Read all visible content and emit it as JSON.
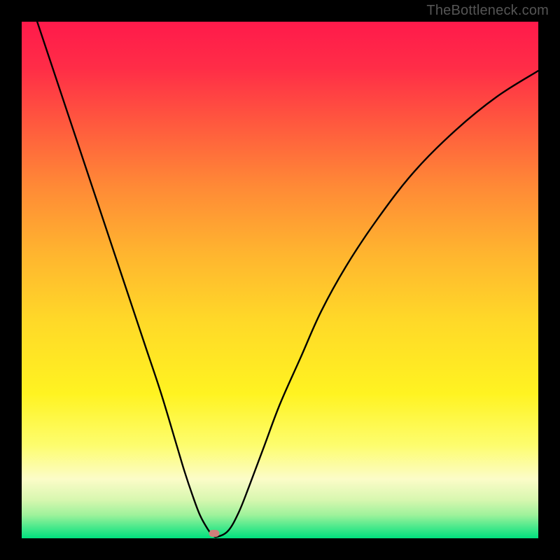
{
  "watermark": "TheBottleneck.com",
  "chart_data": {
    "type": "line",
    "title": "",
    "xlabel": "",
    "ylabel": "",
    "xlim": [
      0,
      100
    ],
    "ylim": [
      0,
      100
    ],
    "grid": false,
    "legend": false,
    "background_gradient": {
      "stops": [
        {
          "pos": 0.0,
          "color": "#ff1a4b"
        },
        {
          "pos": 0.09,
          "color": "#ff2d47"
        },
        {
          "pos": 0.2,
          "color": "#ff5a3e"
        },
        {
          "pos": 0.32,
          "color": "#ff8a36"
        },
        {
          "pos": 0.45,
          "color": "#ffb52f"
        },
        {
          "pos": 0.58,
          "color": "#ffd928"
        },
        {
          "pos": 0.72,
          "color": "#fff321"
        },
        {
          "pos": 0.82,
          "color": "#fdfd6e"
        },
        {
          "pos": 0.885,
          "color": "#fcfcc8"
        },
        {
          "pos": 0.925,
          "color": "#d8f7b0"
        },
        {
          "pos": 0.955,
          "color": "#9ef29b"
        },
        {
          "pos": 0.978,
          "color": "#4be98c"
        },
        {
          "pos": 1.0,
          "color": "#00e07e"
        }
      ]
    },
    "series": [
      {
        "name": "bottleneck-curve",
        "color": "#000000",
        "x": [
          3,
          6,
          9,
          12,
          15,
          18,
          21,
          24,
          27,
          30,
          31.5,
          33,
          34.5,
          36,
          37,
          37.9,
          40,
          42,
          44,
          47,
          50,
          54,
          58,
          63,
          69,
          76,
          84,
          92,
          100
        ],
        "y": [
          100,
          91,
          82,
          73,
          64,
          55,
          46,
          37,
          28,
          18,
          13,
          8.5,
          4.5,
          1.8,
          0.6,
          0.3,
          1.5,
          5,
          10,
          18,
          26,
          35,
          44,
          53,
          62,
          71,
          79,
          85.5,
          90.5
        ]
      }
    ],
    "marker": {
      "x": 37.2,
      "y": 0.9,
      "color": "#ce7f7a"
    }
  }
}
